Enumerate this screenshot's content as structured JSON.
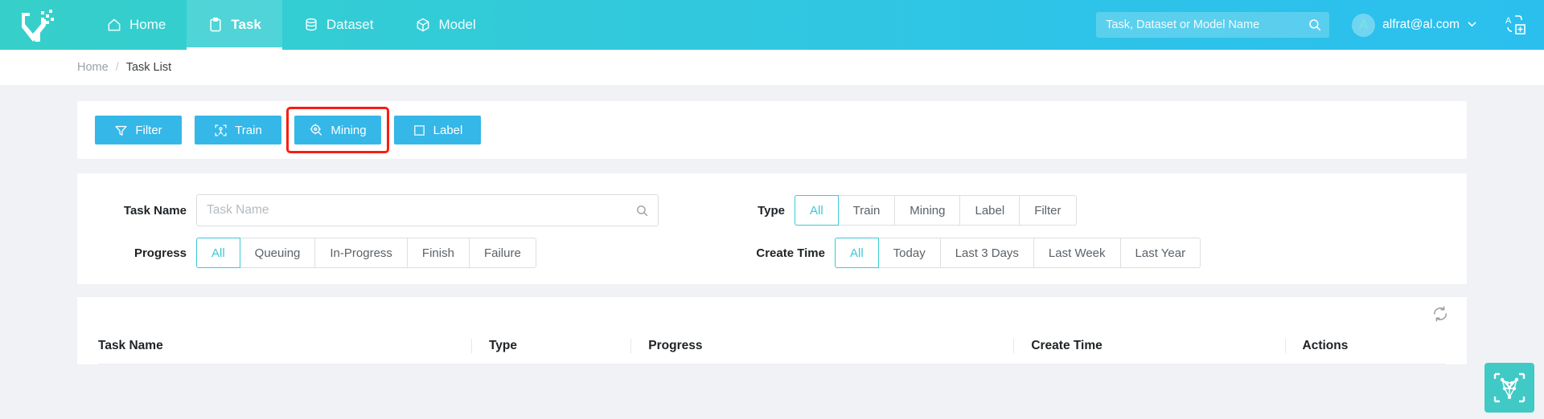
{
  "header": {
    "logo_alt": "ymir-logo",
    "nav": [
      {
        "label": "Home",
        "icon": "home-icon",
        "active": false
      },
      {
        "label": "Task",
        "icon": "task-icon",
        "active": true
      },
      {
        "label": "Dataset",
        "icon": "dataset-icon",
        "active": false
      },
      {
        "label": "Model",
        "icon": "model-icon",
        "active": false
      }
    ],
    "search": {
      "placeholder": "Task, Dataset or Model Name",
      "value": "",
      "icon": "search-icon"
    },
    "user": {
      "avatar_letter": "A",
      "name": "alfrat@al.com",
      "caret": "⌄"
    },
    "language_icon": "language-switch-icon",
    "accent": "#2bbfee",
    "gradient_from": "#36cfc9",
    "gradient_to": "#2bbfee"
  },
  "breadcrumb": {
    "home": "Home",
    "separator": "/",
    "current": "Task List"
  },
  "toolbar": {
    "buttons": [
      {
        "label": "Filter",
        "icon": "funnel-icon",
        "highlighted": false
      },
      {
        "label": "Train",
        "icon": "train-icon",
        "highlighted": false
      },
      {
        "label": "Mining",
        "icon": "mining-icon",
        "highlighted": true
      },
      {
        "label": "Label",
        "icon": "label-icon",
        "highlighted": false
      }
    ],
    "button_color": "#35b7e8",
    "highlight_color": "#f81d11"
  },
  "filters": {
    "task_name": {
      "label": "Task Name",
      "placeholder": "Task Name",
      "value": "",
      "icon": "search-icon"
    },
    "type": {
      "label": "Type",
      "options": [
        "All",
        "Train",
        "Mining",
        "Label",
        "Filter"
      ],
      "selected": "All"
    },
    "progress": {
      "label": "Progress",
      "options": [
        "All",
        "Queuing",
        "In-Progress",
        "Finish",
        "Failure"
      ],
      "selected": "All"
    },
    "create_time": {
      "label": "Create Time",
      "options": [
        "All",
        "Today",
        "Last 3 Days",
        "Last Week",
        "Last Year"
      ],
      "selected": "All"
    },
    "selected_color": "#3bc9d6"
  },
  "table": {
    "refresh_icon": "refresh-icon",
    "columns": [
      "Task Name",
      "Type",
      "Progress",
      "Create Time",
      "Actions"
    ],
    "rows": []
  },
  "fab": {
    "icon": "fox-wireframe-icon",
    "color": "#41c9c6"
  }
}
